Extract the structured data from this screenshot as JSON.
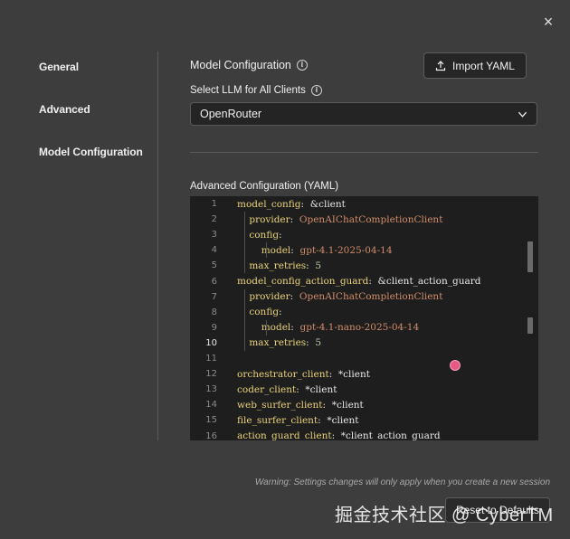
{
  "close_label": "×",
  "nav": {
    "items": [
      {
        "label": "General"
      },
      {
        "label": "Advanced"
      },
      {
        "label": "Model Configuration"
      }
    ]
  },
  "header": {
    "title": "Model Configuration",
    "info": "i",
    "import_label": "Import YAML"
  },
  "llm_select": {
    "label": "Select LLM for All Clients",
    "info": "i",
    "value": "OpenRouter"
  },
  "yaml": {
    "label": "Advanced Configuration (YAML)",
    "lines": [
      {
        "num": "1",
        "tokens": [
          {
            "t": "model_config",
            "c": "k"
          },
          {
            "t": ":  &client",
            "c": "p"
          }
        ]
      },
      {
        "num": "2",
        "tokens": [
          {
            "t": "    provider",
            "c": "k"
          },
          {
            "t": ":  ",
            "c": "p"
          },
          {
            "t": "OpenAIChatCompletionClient",
            "c": "s"
          }
        ]
      },
      {
        "num": "3",
        "tokens": [
          {
            "t": "    config",
            "c": "k"
          },
          {
            "t": ":",
            "c": "p"
          }
        ]
      },
      {
        "num": "4",
        "tokens": [
          {
            "t": "        model",
            "c": "k"
          },
          {
            "t": ":  ",
            "c": "p"
          },
          {
            "t": "gpt-4.1-2025-04-14",
            "c": "s"
          }
        ]
      },
      {
        "num": "5",
        "tokens": [
          {
            "t": "    max_retries",
            "c": "k"
          },
          {
            "t": ":  ",
            "c": "p"
          },
          {
            "t": "5",
            "c": "n"
          }
        ]
      },
      {
        "num": "6",
        "tokens": [
          {
            "t": "model_config_action_guard",
            "c": "k"
          },
          {
            "t": ":  &client_action_guard",
            "c": "p"
          }
        ]
      },
      {
        "num": "7",
        "tokens": [
          {
            "t": "    provider",
            "c": "k"
          },
          {
            "t": ":  ",
            "c": "p"
          },
          {
            "t": "OpenAIChatCompletionClient",
            "c": "s"
          }
        ]
      },
      {
        "num": "8",
        "tokens": [
          {
            "t": "    config",
            "c": "k"
          },
          {
            "t": ":",
            "c": "p"
          }
        ]
      },
      {
        "num": "9",
        "tokens": [
          {
            "t": "        model",
            "c": "k"
          },
          {
            "t": ":  ",
            "c": "p"
          },
          {
            "t": "gpt-4.1-nano-2025-04-14",
            "c": "s"
          }
        ]
      },
      {
        "num": "10",
        "active": true,
        "tokens": [
          {
            "t": "    max_retries",
            "c": "k"
          },
          {
            "t": ":  ",
            "c": "p"
          },
          {
            "t": "5",
            "c": "n"
          }
        ]
      },
      {
        "num": "11",
        "tokens": []
      },
      {
        "num": "12",
        "tokens": [
          {
            "t": "orchestrator_client",
            "c": "k"
          },
          {
            "t": ":  *client",
            "c": "p"
          }
        ]
      },
      {
        "num": "13",
        "tokens": [
          {
            "t": "coder_client",
            "c": "k"
          },
          {
            "t": ":  *client",
            "c": "p"
          }
        ]
      },
      {
        "num": "14",
        "tokens": [
          {
            "t": "web_surfer_client",
            "c": "k"
          },
          {
            "t": ":  *client",
            "c": "p"
          }
        ]
      },
      {
        "num": "15",
        "tokens": [
          {
            "t": "file_surfer_client",
            "c": "k"
          },
          {
            "t": ":  *client",
            "c": "p"
          }
        ]
      },
      {
        "num": "16",
        "tokens": [
          {
            "t": "action_guard_client",
            "c": "k"
          },
          {
            "t": ":  *client_action_guard",
            "c": "p"
          }
        ]
      }
    ]
  },
  "footer": {
    "warning": "Warning: Settings changes will only apply when you create a new session",
    "reset_label": "Reset to Defaults",
    "watermark": "掘金技术社区 @ CyberTM"
  }
}
